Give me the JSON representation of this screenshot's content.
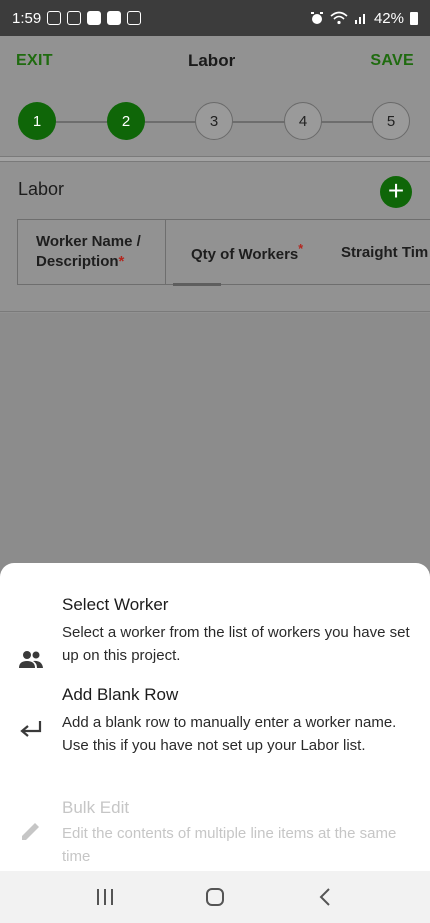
{
  "status_bar": {
    "time": "1:59",
    "battery": "42%",
    "left_icons": [
      "calendar-icon",
      "message-icon",
      "notification-icon",
      "image-icon",
      "news-icon"
    ],
    "right_icons": [
      "alarm-icon",
      "wifi-icon",
      "signal-icon",
      "battery-icon"
    ]
  },
  "header": {
    "exit_label": "EXIT",
    "title": "Labor",
    "save_label": "SAVE"
  },
  "stepper": {
    "steps": [
      "1",
      "2",
      "3",
      "4",
      "5"
    ],
    "completed_count": 2
  },
  "labor": {
    "section_title": "Labor",
    "add_icon": "plus-icon",
    "columns": [
      {
        "label": "Worker Name / Description",
        "required": true
      },
      {
        "label": "Qty of Workers",
        "required": true
      },
      {
        "label": "Straight Tim",
        "required": false
      }
    ],
    "required_mark": "*"
  },
  "sheet": {
    "options": [
      {
        "icon": "people-icon",
        "title": "Select Worker",
        "description": "Select a worker from the list of workers you have set up on this project.",
        "enabled": true
      },
      {
        "icon": "enter-arrow-icon",
        "title": "Add Blank Row",
        "description": "Add a blank row to manually enter a worker name. Use this if you have not set up your Labor list.",
        "enabled": true
      },
      {
        "icon": "pencil-icon",
        "title": "Bulk Edit",
        "description": "Edit the contents of multiple line items at the same time",
        "enabled": false
      }
    ]
  },
  "navbar": {
    "buttons": [
      "recents-icon",
      "home-icon",
      "back-icon"
    ]
  },
  "colors": {
    "accent_green": "#0f6608",
    "header_green": "#1f6b0f",
    "required_red": "#b3261e"
  }
}
